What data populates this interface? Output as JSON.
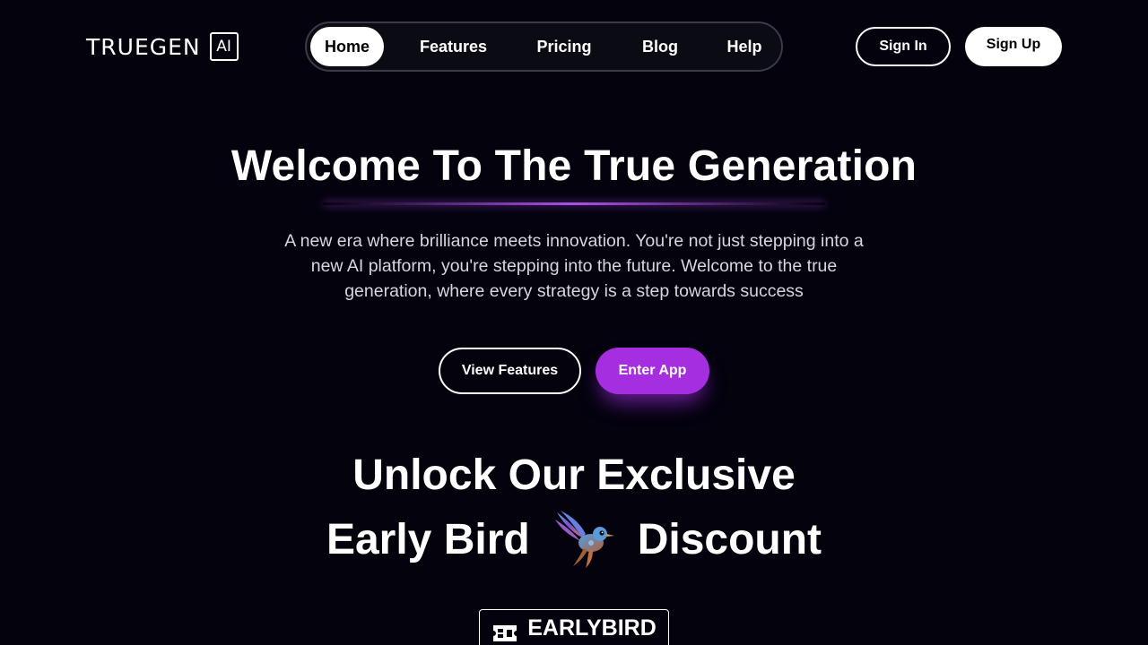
{
  "header": {
    "logo_text": "TRUEGEN",
    "logo_badge": "AI",
    "nav": [
      {
        "label": "Home",
        "active": true
      },
      {
        "label": "Features",
        "active": false
      },
      {
        "label": "Pricing",
        "active": false
      },
      {
        "label": "Blog",
        "active": false
      },
      {
        "label": "Help",
        "active": false
      }
    ],
    "sign_in_label": "Sign In",
    "sign_up_label": "Sign Up"
  },
  "hero": {
    "title": "Welcome To The True Generation",
    "subtitle": "A new era where brilliance meets innovation. You're not just stepping into a new AI platform, you're stepping into the future. Welcome to the true generation, where every strategy is a step towards success",
    "view_features_label": "View Features",
    "enter_app_label": "Enter App"
  },
  "discount": {
    "line1": "Unlock Our Exclusive",
    "line2_left": "Early Bird",
    "line2_right": "Discount",
    "bird_icon": "hummingbird-icon",
    "code_icon": "ticket-icon",
    "code": "EARLYBIRD"
  },
  "colors": {
    "background": "#03020d",
    "accent": "#a52fe0",
    "text": "#ffffff"
  }
}
